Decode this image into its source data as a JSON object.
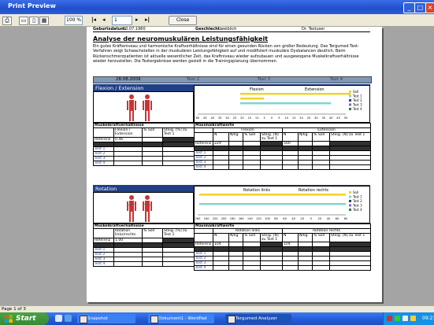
{
  "window": {
    "title": "Print Preview"
  },
  "toolbar": {
    "zoom": "100 %",
    "page": "1",
    "close_label": "Close"
  },
  "report": {
    "header_left": "Geburtsdatum:",
    "header_left_val": "10.07.1960",
    "header_mid": "Geschlecht:",
    "header_mid_val": "weiblich",
    "header_right": "Dr. Testuser",
    "title": "Analyse der neuromuskulären Leistungsfähigkeit",
    "intro": "Ein gutes Kräfteniveau und harmonische Kraftverhältnisse sind für einen gesunden Rücken von großer Bedeutung. Das Tergumed Test-Verfahren zeigt Schwachstellen in der muskulären Leistungsfähigkeit auf und modifiziert muskuläre Dysbalancen deutlich. Beim Rückenschmerzpatienten ist aktuelle wesentlicher Zeit, das Kraftniveau wieder aufzubauen und ausgewogene Muskelkraftverhältnisse wieder herzustellen. Die Testergebnisse werden gezielt in die Trainingsplanung übernommen.",
    "dates": [
      "28.08.2009",
      "Test 2",
      "Test 3",
      "Test 4"
    ]
  },
  "sections": [
    {
      "title": "Flexion / Extension",
      "left_label": "Flexion",
      "right_label": "Extension",
      "scale": [
        "60",
        "45",
        "40",
        "35",
        "30",
        "25",
        "20",
        "15",
        "10",
        "5",
        "0",
        "5",
        "10",
        "15",
        "20",
        "25",
        "30",
        "35",
        "40",
        "45",
        "50"
      ],
      "legend": [
        "Soll",
        "Test 1",
        "Test 2",
        "Test 3",
        "Test 4"
      ],
      "table1_title": "Muskelkraftverhältnisse",
      "table2_title": "Maximalkraftwerte",
      "t1_cols": [
        "",
        "Flexion / Extension",
        "% Soll",
        "Steig. [%] zu Test 1"
      ],
      "t2_group_left": "Flexion",
      "t2_group_right": "Extension",
      "t2_cols": [
        "",
        "N",
        "N/kg",
        "% Soll",
        "Steig. [N] zu Test 1",
        "N",
        "N/kg",
        "% Soll",
        "Steig. [N] zu Test 1"
      ],
      "row_label": "Referenz",
      "ratio": "0.46",
      "left_value": "229",
      "right_value": "500",
      "tests": [
        "Test 1",
        "Test 2",
        "Test 3",
        "Test 4"
      ]
    },
    {
      "title": "Rotation",
      "left_label": "Rotation links",
      "right_label": "Rotation rechts",
      "scale": [
        "260",
        "240",
        "220",
        "200",
        "180",
        "160",
        "140",
        "120",
        "100",
        "80",
        "60",
        "40",
        "20",
        "0",
        "20",
        "40",
        "60",
        "80"
      ],
      "legend": [
        "Soll",
        "Test 1",
        "Test 2",
        "Test 3",
        "Test 4"
      ],
      "table1_title": "Muskelkraftverhältnisse",
      "table2_title": "Maximalkraftwerte",
      "t1_cols": [
        "",
        "Rotation links/rechts",
        "% Soll",
        "Steig. [%] zu Test 1"
      ],
      "t2_group_left": "Rotation links",
      "t2_group_right": "Rotation rechts",
      "t2_cols": [
        "",
        "N",
        "N/kg",
        "% Soll",
        "Steig. [N] zu Test 1",
        "N",
        "N/kg",
        "% Soll",
        "Steig. [N] zu Test 1"
      ],
      "row_label": "Referenz",
      "ratio": "1.00",
      "left_value": "104",
      "right_value": "104",
      "tests": [
        "Test 1",
        "Test 2",
        "Test 3",
        "Test 4"
      ]
    }
  ],
  "chart_data": [
    {
      "type": "bar",
      "title": "Flexion / Extension",
      "series": [
        {
          "name": "Soll",
          "color": "#f2d22b"
        },
        {
          "name": "Test 1",
          "color": "#7fd4d4"
        }
      ]
    },
    {
      "type": "bar",
      "title": "Rotation",
      "series": [
        {
          "name": "Soll",
          "color": "#f2d22b"
        },
        {
          "name": "Test 1",
          "color": "#7fd4d4"
        }
      ]
    }
  ],
  "colors": {
    "soll": "#f2d22b",
    "test1": "#7fd4d4",
    "test2": "#1f3f86",
    "test3": "#7b68c8",
    "test4": "#2f7d3a"
  },
  "status": {
    "page_info": "Page 1 of 3"
  },
  "taskbar": {
    "start": "Start",
    "tasks": [
      "Snapshot",
      "Dokument1 - WordPad",
      "Tergumed Analyzer"
    ],
    "clock": "09:21"
  }
}
